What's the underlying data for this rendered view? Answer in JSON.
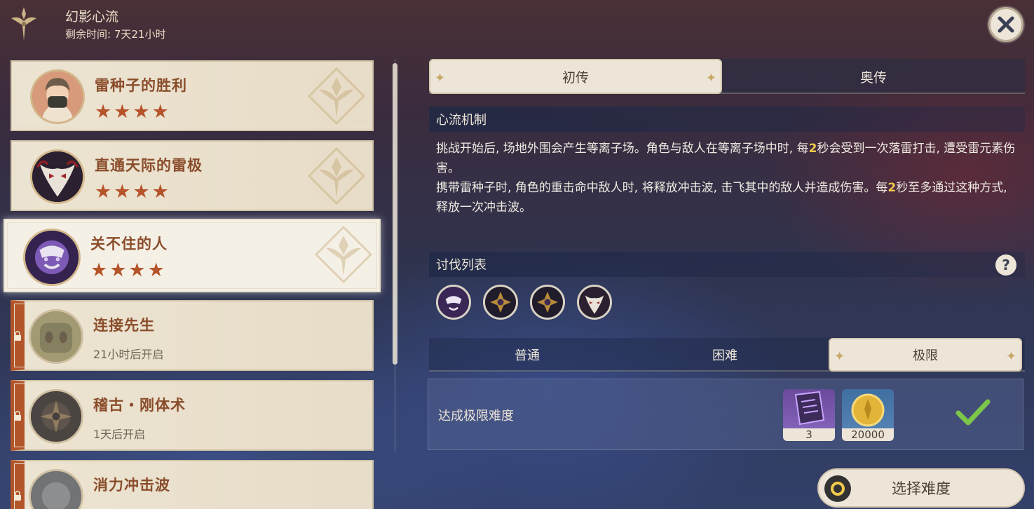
{
  "header": {
    "title": "幻影心流",
    "remaining": "剩余时间: 7天21小时"
  },
  "challenges": [
    {
      "title": "雷种子的胜利",
      "stars": "★★★★",
      "locked": false
    },
    {
      "title": "直通天际的雷极",
      "stars": "★★★★",
      "locked": false
    },
    {
      "title": "关不住的人",
      "stars": "★★★★",
      "locked": false,
      "selected": true
    },
    {
      "title": "连接先生",
      "subtitle": "21小时后开启",
      "locked": true
    },
    {
      "title": "稽古・刚体术",
      "subtitle": "1天后开启",
      "locked": true
    },
    {
      "title": "消力冲击波",
      "locked": true
    }
  ],
  "tabs": {
    "first": "初传",
    "second": "奥传"
  },
  "mechanism": {
    "header": "心流机制",
    "p1_a": "挑战开始后, 场地外围会产生等离子场。角色与敌人在等离子场中时, 每",
    "p1_num": "2",
    "p1_b": "秒会受到一次落雷打击, 遭受雷元素伤害。",
    "p2_a": "携带雷种子时, 角色的重击命中敌人时, 将释放冲击波, 击飞其中的敌人并造成伤害。每",
    "p2_num": "2",
    "p2_b": "秒至多通过这种方式, 释放一次冲击波。"
  },
  "enemies": {
    "header": "讨伐列表",
    "help": "?"
  },
  "difficulty": {
    "normal": "普通",
    "hard": "困难",
    "extreme": "极限"
  },
  "reward": {
    "label": "达成极限难度",
    "items": [
      {
        "name": "book",
        "count": "3"
      },
      {
        "name": "mora",
        "count": "20000"
      }
    ]
  },
  "select_button": "选择难度"
}
